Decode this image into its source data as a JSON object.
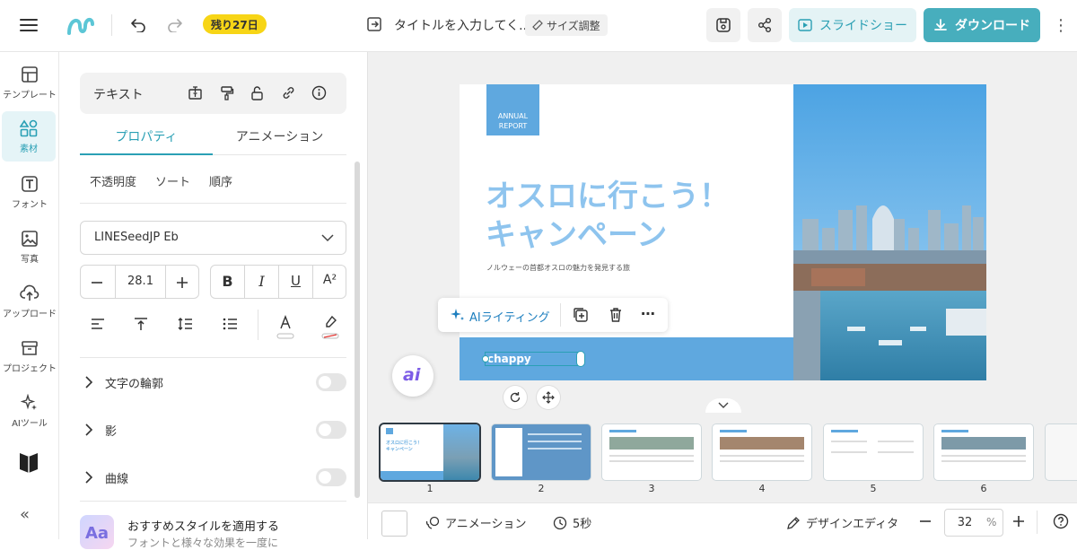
{
  "topbar": {
    "days_left_badge": "残り27日",
    "doc_title": "タイトルを入力してく...",
    "resize_label": "サイズ調整",
    "slideshow_label": "スライドショー",
    "download_label": "ダウンロード"
  },
  "sidebar": {
    "items": [
      {
        "label": "テンプレート",
        "icon": "template-icon"
      },
      {
        "label": "素材",
        "icon": "elements-icon"
      },
      {
        "label": "フォント",
        "icon": "font-icon"
      },
      {
        "label": "写真",
        "icon": "photo-icon"
      },
      {
        "label": "アップロード",
        "icon": "upload-icon"
      },
      {
        "label": "プロジェクト",
        "icon": "project-icon"
      },
      {
        "label": "AIツール",
        "icon": "ai-tools-icon"
      }
    ]
  },
  "panel": {
    "header_label": "テキスト",
    "tabs": [
      "プロパティ",
      "アニメーション"
    ],
    "sub_tabs": [
      "不透明度",
      "ソート",
      "順序"
    ],
    "font_family": "LINESeedJP Eb",
    "font_size": "28.1",
    "sections": [
      "文字の輪郭",
      "影",
      "曲線"
    ],
    "style_title": "おすすめスタイルを適用する",
    "style_sub": "フォントと様々な効果を一度に",
    "style_thumb_text": "Aa"
  },
  "slide": {
    "annual_report": "ANNUAL\nREPORT",
    "title_line1": "オスロに行こう！",
    "title_line2": "キャンペーン",
    "subtitle": "ノルウェーの首都オスロの魅力を発見する旅",
    "footer_text": "chappy"
  },
  "floating_toolbar": {
    "ai_writing_label": "AIライティング",
    "ai_button_text": "ai"
  },
  "thumbnails": {
    "numbers": [
      "1",
      "2",
      "3",
      "4",
      "5",
      "6"
    ],
    "thumb1_title": "オスロに行こう！\nキャンペーン"
  },
  "bottombar": {
    "animation_label": "アニメーション",
    "duration_label": "5秒",
    "design_editor_label": "デザインエディタ",
    "zoom_value": "32",
    "zoom_unit": "%"
  },
  "colors": {
    "accent": "#2aa0b5",
    "download_bg": "#47aebd",
    "slideshow_bg": "#e4f3f5",
    "slide_blue": "#5fa8df",
    "badge_yellow": "#f7d516"
  }
}
